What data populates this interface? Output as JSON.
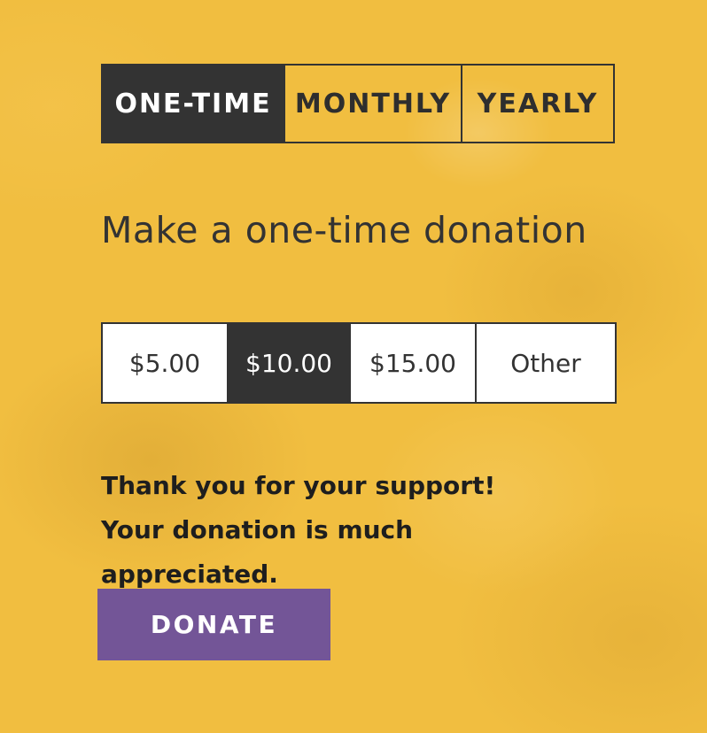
{
  "frequency_tabs": [
    {
      "label": "ONE-TIME",
      "active": true
    },
    {
      "label": "MONTHLY",
      "active": false
    },
    {
      "label": "YEARLY",
      "active": false
    }
  ],
  "heading": "Make a one-time donation",
  "amounts": [
    {
      "label": "$5.00",
      "selected": false
    },
    {
      "label": "$10.00",
      "selected": true
    },
    {
      "label": "$15.00",
      "selected": false
    },
    {
      "label": "Other",
      "selected": false
    }
  ],
  "thank_you_message": "Thank you for your support! Your donation is much appreciated.",
  "donate_button": {
    "label": "DONATE"
  },
  "colors": {
    "background": "#f1be40",
    "dark": "#333333",
    "white": "#ffffff",
    "button": "#735597"
  }
}
